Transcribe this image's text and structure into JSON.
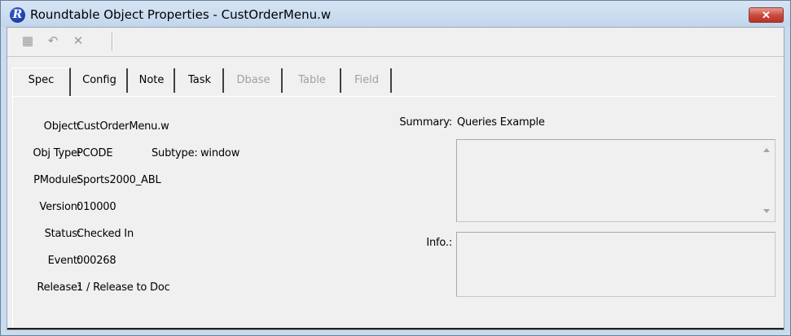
{
  "window": {
    "title": "Roundtable Object Properties - CustOrderMenu.w",
    "app_icon_letter": "R",
    "close_glyph": "✕"
  },
  "toolbar": {
    "buttons": [
      {
        "name": "save-icon",
        "glyph": "▦"
      },
      {
        "name": "undo-icon",
        "glyph": "↶"
      },
      {
        "name": "delete-icon",
        "glyph": "✕"
      }
    ]
  },
  "tabs": [
    {
      "label": "Spec",
      "state": "active"
    },
    {
      "label": "Config",
      "state": "enabled"
    },
    {
      "label": "Note",
      "state": "enabled"
    },
    {
      "label": "Task",
      "state": "enabled"
    },
    {
      "label": "Dbase",
      "state": "disabled"
    },
    {
      "label": "Table",
      "state": "disabled"
    },
    {
      "label": "Field",
      "state": "disabled"
    }
  ],
  "spec": {
    "object_label": "Object:",
    "object_value": "CustOrderMenu.w",
    "objtype_label": "Obj Type:",
    "objtype_value": "PCODE",
    "subtype_label": "Subtype:",
    "subtype_value": "window",
    "pmodule_label": "PModule:",
    "pmodule_value": "Sports2000_ABL",
    "version_label": "Version:",
    "version_value": "010000",
    "status_label": "Status:",
    "status_value": "Checked In",
    "event_label": "Event:",
    "event_value": "000268",
    "release_label": "Release:",
    "release_value": "1 / Release to Doc",
    "summary_label": "Summary:",
    "summary_value": "Queries Example",
    "summary_text": "",
    "info_label": "Info.:",
    "info_text": ""
  },
  "colors": {
    "titlebar": "#c9dbee",
    "client_bg": "#f0f0f0",
    "close_button": "#c9473a",
    "disabled_text": "#a0a0a0"
  }
}
